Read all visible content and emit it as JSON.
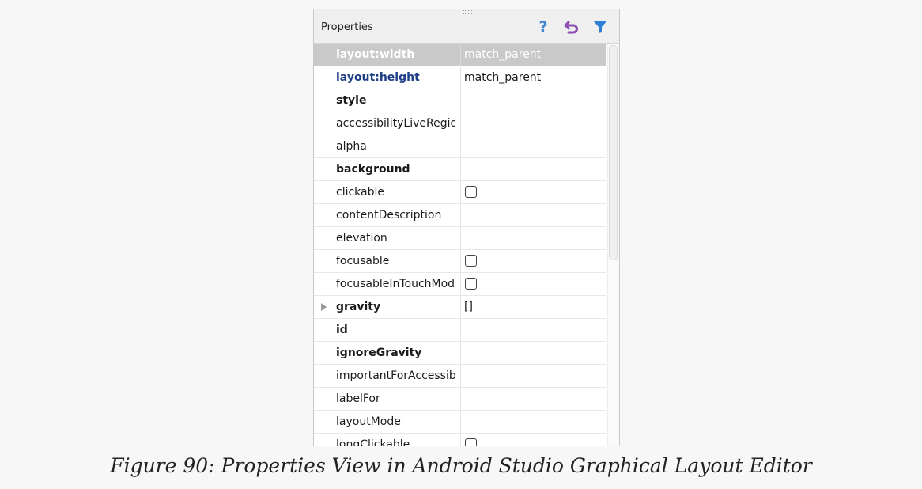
{
  "panel": {
    "title": "Properties",
    "toolbar": {
      "help_icon": "?",
      "icons": [
        "help-icon",
        "restore-default-icon",
        "filter-icon"
      ]
    },
    "colors": {
      "help": "#3f86cf",
      "restore": "#8a4fb0",
      "filter": "#2f7fd6",
      "selected_row": "#c9c9c9",
      "layout_attr": "#1f3f88"
    },
    "rows": [
      {
        "name": "layout:width",
        "value": "match_parent",
        "style": "blue",
        "selected": true
      },
      {
        "name": "layout:height",
        "value": "match_parent",
        "style": "blue"
      },
      {
        "name": "style",
        "value": "",
        "style": "bold"
      },
      {
        "name": "accessibilityLiveRegion",
        "value": "",
        "style": "normal"
      },
      {
        "name": "alpha",
        "value": "",
        "style": "normal"
      },
      {
        "name": "background",
        "value": "",
        "style": "bold"
      },
      {
        "name": "clickable",
        "value": "",
        "style": "normal",
        "checkbox": true,
        "checked": false
      },
      {
        "name": "contentDescription",
        "value": "",
        "style": "normal"
      },
      {
        "name": "elevation",
        "value": "",
        "style": "normal"
      },
      {
        "name": "focusable",
        "value": "",
        "style": "normal",
        "checkbox": true,
        "checked": false
      },
      {
        "name": "focusableInTouchMode",
        "value": "",
        "style": "normal",
        "checkbox": true,
        "checked": false
      },
      {
        "name": "gravity",
        "value": "[]",
        "style": "bold",
        "expandable": true
      },
      {
        "name": "id",
        "value": "",
        "style": "bold"
      },
      {
        "name": "ignoreGravity",
        "value": "",
        "style": "bold"
      },
      {
        "name": "importantForAccessibility",
        "value": "",
        "style": "normal"
      },
      {
        "name": "labelFor",
        "value": "",
        "style": "normal"
      },
      {
        "name": "layoutMode",
        "value": "",
        "style": "normal"
      },
      {
        "name": "longClickable",
        "value": "",
        "style": "normal",
        "checkbox": true,
        "checked": false
      }
    ]
  },
  "caption": "Figure 90: Properties View in Android Studio Graphical Layout Editor"
}
